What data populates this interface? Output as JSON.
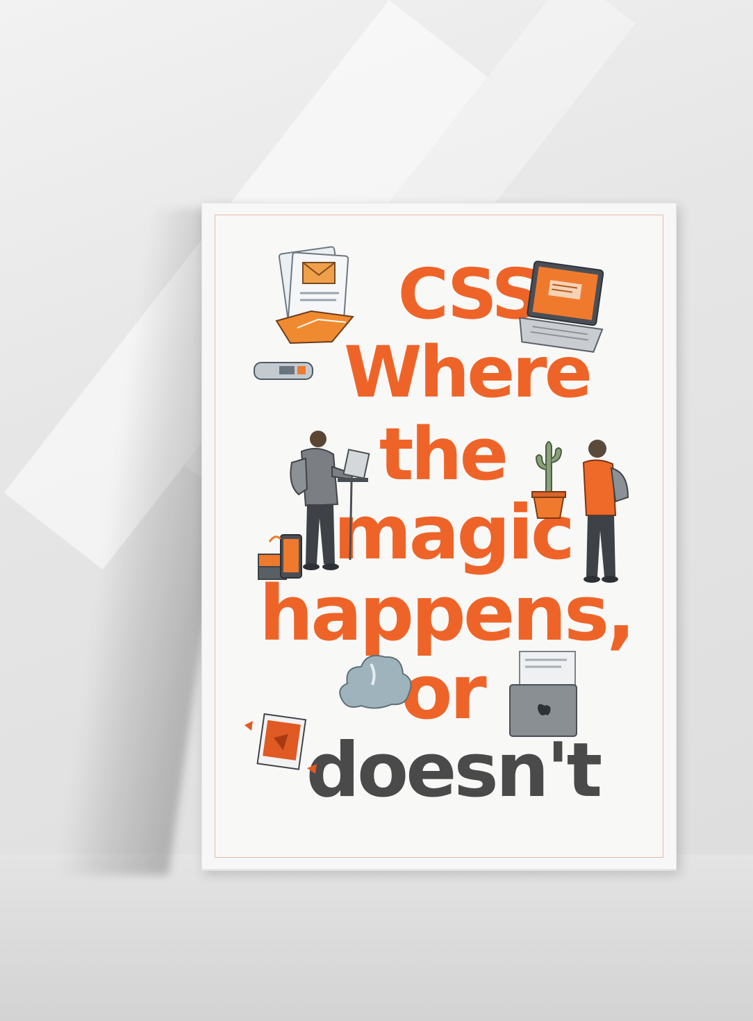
{
  "poster": {
    "lines": [
      "CSS:",
      "Where",
      "the",
      "magic",
      "happens,",
      "or",
      "doesn't"
    ]
  },
  "colors": {
    "accent_orange": "#ee6428",
    "dark_text": "#4a4a4a",
    "frame": "#f7f7f7",
    "wall": "#e6e6e6"
  },
  "icons": [
    "envelope-icon",
    "laptop-icon",
    "usb-drive-icon",
    "person-with-laptop-icon",
    "cactus-plant-icon",
    "person-with-backpack-icon",
    "phone-stack-icon",
    "cloud-icon",
    "computer-monitor-icon",
    "photo-card-icon"
  ]
}
